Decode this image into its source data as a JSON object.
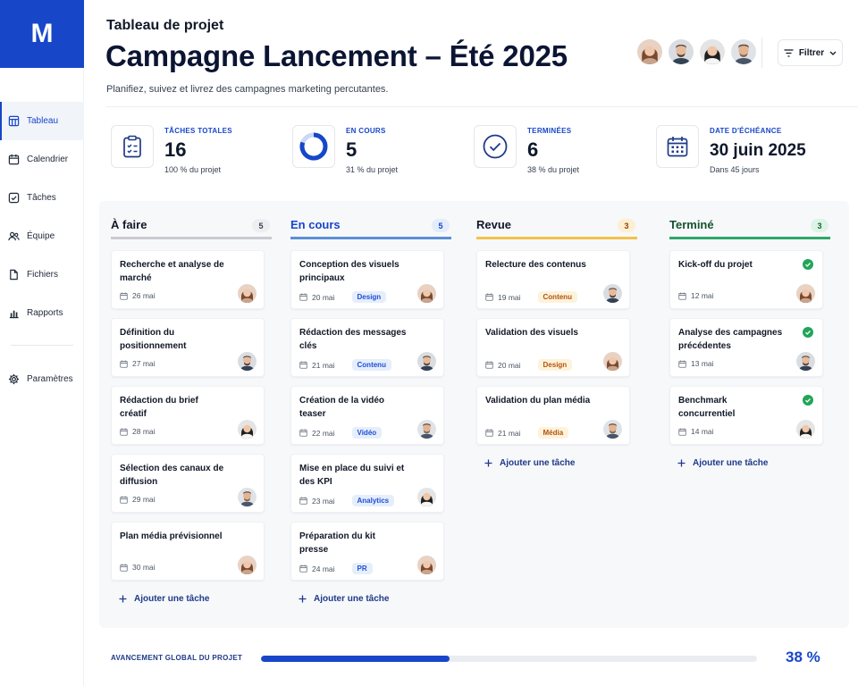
{
  "brand": {
    "logo_letter": "M"
  },
  "sidebar": {
    "items": [
      {
        "label": "Tableau",
        "icon": "board-icon",
        "active": true
      },
      {
        "label": "Calendrier",
        "icon": "calendar-icon"
      },
      {
        "label": "Tâches",
        "icon": "checkbox-icon"
      },
      {
        "label": "Équipe",
        "icon": "team-icon"
      },
      {
        "label": "Fichiers",
        "icon": "file-icon"
      },
      {
        "label": "Rapports",
        "icon": "bar-chart-icon"
      }
    ],
    "settings": {
      "label": "Paramètres",
      "icon": "gear-icon"
    }
  },
  "header": {
    "breadcrumb": "Tableau de projet",
    "title": "Campagne Lancement – Été 2025",
    "subtitle": "Planifiez, suivez et livrez des campagnes marketing percutantes.",
    "filter_label": "Filtrer"
  },
  "stats": [
    {
      "label": "Tâches totales",
      "value": "16",
      "sub": "100 % du projet",
      "icon": "clipboard-icon"
    },
    {
      "label": "En cours",
      "value": "5",
      "sub": "31 % du projet",
      "icon": "progress-ring-icon"
    },
    {
      "label": "Terminées",
      "value": "6",
      "sub": "38 % du projet",
      "icon": "check-circle-icon"
    },
    {
      "label": "Date d'échéance",
      "value": "30 juin 2025",
      "sub": "Dans 45 jours",
      "icon": "calendar-icon"
    }
  ],
  "columns": [
    {
      "title": "À faire",
      "count": "5",
      "color": "#c9cbd0",
      "title_color": "#111827",
      "count_bg": "#eceef1",
      "count_color": "#374151",
      "cards": [
        {
          "title": "Recherche et analyse de marché",
          "date": "26 mai",
          "avatar": "f1"
        },
        {
          "title": "Définition du positionnement",
          "date": "27 mai",
          "avatar": "m1"
        },
        {
          "title": "Rédaction du brief créatif",
          "date": "28 mai",
          "avatar": "f2"
        },
        {
          "title": "Sélection des canaux de diffusion",
          "date": "29 mai",
          "avatar": "m2"
        },
        {
          "title": "Plan média prévisionnel",
          "date": "30 mai",
          "avatar": "f1"
        }
      ],
      "add_label": "Ajouter une tâche"
    },
    {
      "title": "En cours",
      "count": "5",
      "color": "#5b8fd6",
      "title_color": "#1746c9",
      "count_bg": "#e3ecfa",
      "count_color": "#1746c9",
      "cards": [
        {
          "title": "Conception des visuels principaux",
          "date": "20 mai",
          "tag": "Design",
          "avatar": "f1"
        },
        {
          "title": "Rédaction des messages clés",
          "date": "21 mai",
          "tag": "Contenu",
          "avatar": "m1"
        },
        {
          "title": "Création de la vidéo teaser",
          "date": "22 mai",
          "tag": "Vidéo",
          "avatar": "m2"
        },
        {
          "title": "Mise en place du suivi et des KPI",
          "date": "23 mai",
          "tag": "Analytics",
          "avatar": "f2"
        },
        {
          "title": "Préparation du kit presse",
          "date": "24 mai",
          "tag": "PR",
          "avatar": "f1"
        }
      ],
      "add_label": "Ajouter une tâche"
    },
    {
      "title": "Revue",
      "count": "3",
      "color": "#f2c24a",
      "title_color": "#111827",
      "count_bg": "#fcefd2",
      "count_color": "#92400e",
      "cards": [
        {
          "title": "Relecture des contenus",
          "date": "19 mai",
          "tag": "Contenu",
          "avatar": "m1"
        },
        {
          "title": "Validation des visuels",
          "date": "20 mai",
          "tag": "Design",
          "avatar": "f1"
        },
        {
          "title": "Validation du plan média",
          "date": "21 mai",
          "tag": "Média",
          "avatar": "m2"
        }
      ],
      "add_label": "Ajouter une tâche"
    },
    {
      "title": "Terminé",
      "count": "3",
      "color": "#2ea86a",
      "title_color": "#14532d",
      "count_bg": "#ddf3e6",
      "count_color": "#166534",
      "cards": [
        {
          "title": "Kick-off du projet",
          "date": "12 mai",
          "avatar": "f1",
          "done": true
        },
        {
          "title": "Analyse des campagnes précédentes",
          "date": "13 mai",
          "avatar": "m1",
          "done": true
        },
        {
          "title": "Benchmark concurrentiel",
          "date": "14 mai",
          "avatar": "f2",
          "done": true
        }
      ],
      "add_label": "Ajouter une tâche"
    }
  ],
  "tag_styles": {
    "Design": {
      "bg": "#e6eefb",
      "fg": "#1d4ed8"
    },
    "Contenu": {
      "bg": "#e6eefb",
      "fg": "#1d4ed8"
    },
    "Vidéo": {
      "bg": "#e6eefb",
      "fg": "#1d4ed8"
    },
    "Analytics": {
      "bg": "#e6eefb",
      "fg": "#1d4ed8"
    },
    "PR": {
      "bg": "#e6eefb",
      "fg": "#1d4ed8"
    },
    "Revue": {
      "bg": "#fdf3dc",
      "fg": "#b45309"
    }
  },
  "progress": {
    "label": "Avancement global du projet",
    "percent_text": "38 %",
    "fraction": 0.38
  },
  "colors": {
    "brand": "#1746c9"
  }
}
